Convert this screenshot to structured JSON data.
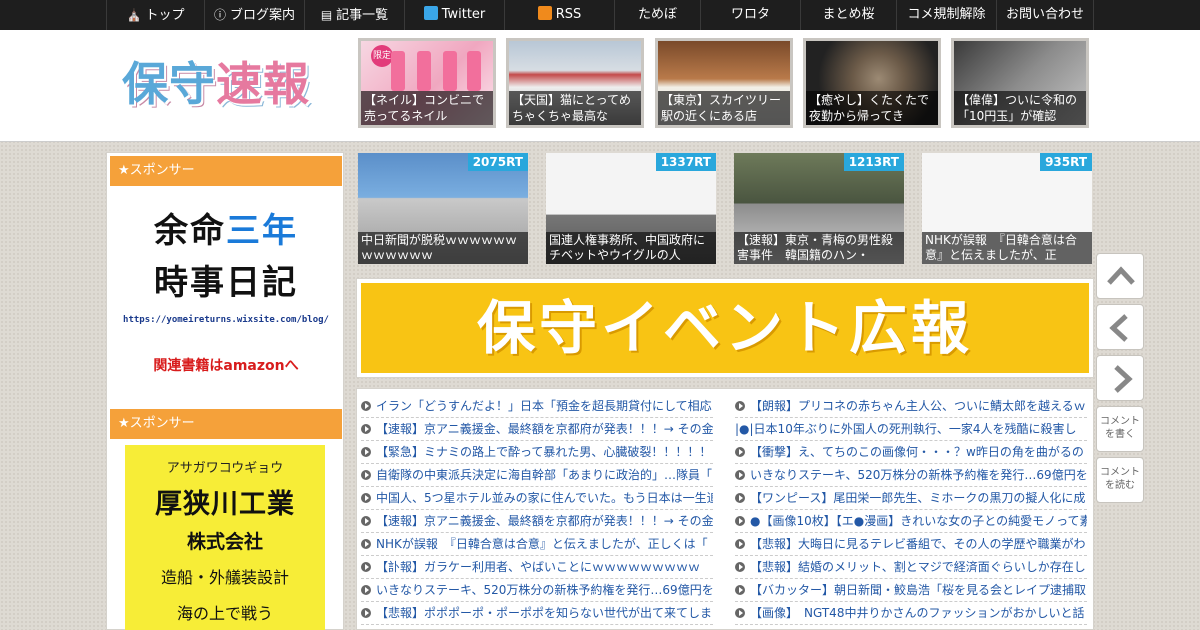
{
  "nav": {
    "items": [
      "トップ",
      "ブログ案内",
      "記事一覧",
      "Twitter",
      "RSS",
      "ためぼ",
      "ワロタ",
      "まとめ桜",
      "コメ規制解除",
      "お問い合わせ"
    ]
  },
  "header": {
    "logo_a": "保守",
    "logo_b": "速報",
    "thumbs": [
      {
        "caption": "【ネイル】コンビニで売ってるネイル",
        "tag": "限定"
      },
      {
        "caption": "【天国】猫にとってめちゃくちゃ最高な"
      },
      {
        "caption": "【東京】スカイツリー駅の近くにある店"
      },
      {
        "caption": "【癒やし】くたくたで夜勤から帰ってき"
      },
      {
        "caption": "【偉偉】ついに令和の「10円玉」が確認"
      }
    ]
  },
  "sidebar": {
    "heading1": "★スポンサー",
    "ad1_line1a": "余命",
    "ad1_line1b": "三年",
    "ad1_line2": "時事日記",
    "ad1_url": "https://yomeireturns.wixsite.com/blog/",
    "ad1_amazon": "関連書籍はamazonへ",
    "heading2": "★スポンサー",
    "ad2_kana": "アサガワコウギョウ",
    "ad2_name": "厚狭川工業",
    "ad2_corp": "株式会社",
    "ad2_desc": "造船・外艤装設計",
    "ad2_more": "海の上で戦う"
  },
  "rt_cards": [
    {
      "badge": "2075RT",
      "caption": "中日新聞が脱税ｗｗｗｗｗｗｗｗｗｗｗｗ"
    },
    {
      "badge": "1337RT",
      "caption": "国連人権事務所、中国政府にチベットやウイグルの人"
    },
    {
      "badge": "1213RT",
      "caption": "【速報】東京・青梅の男性殺害事件　韓国籍のハン・"
    },
    {
      "badge": "935RT",
      "caption": "NHKが誤報　『日韓合意は合意』と伝えましたが、正"
    }
  ],
  "banner": {
    "text": "保守イベント広報"
  },
  "articles_left": [
    "イラン「どうすんだよ！」日本「預金を超長期貸付にして相応",
    "【速報】京アニ義援金、最終額を京都府が発表！！！→ その金",
    "【緊急】ミナミの路上で酔って暴れた男、心臓破裂！！！！！",
    "自衛隊の中東派兵決定に海自幹部「あまりに政治的」…隊員「",
    "中国人、5つ星ホテル並みの家に住んでいた。もう日本は一生追",
    "【速報】京アニ義援金、最終額を京都府が発表！！！→ その金",
    "NHKが誤報　『日韓合意は合意』と伝えましたが、正しくは「",
    "【訃報】ガラケー利用者、やばいことにｗｗｗｗｗｗｗｗｗ",
    "いきなりステーキ、520万株分の新株予約権を発行…69億円を調",
    "【悲報】ポポポーポ・ポーポポを知らない世代が出て来てしま"
  ],
  "articles_right": [
    "【朗報】プリコネの赤ちゃん主人公、ついに鯖太郎を越えるｗ",
    "|●|日本10年ぶりに外国人の死刑執行、一家4人を残酷に殺害し",
    "【衝撃】え、てちのこの画像何・・・？w昨日の角を曲がるの",
    "いきなりステーキ、520万株分の新株予約権を発行…69億円を調",
    "【ワンピース】尾田栄一郎先生、ミホークの黒刀の擬人化に成",
    "●【画像10枚】【エ●漫画】きれいな女の子との純愛モノって素",
    "【悲報】大晦日に見るテレビ番組で、その人の学歴や職業がわ",
    "【悲報】結婚のメリット、割とマジで経済面ぐらいしか存在し",
    "【バカッター】朝日新聞・鮫島浩「桜を見る会とレイプ逮捕取",
    "【画像】　NGT48中井りかさんのファッションがおかしいと話"
  ],
  "tools": {
    "comment_write": "コメントを書く",
    "comment_read": "コメントを読む"
  }
}
